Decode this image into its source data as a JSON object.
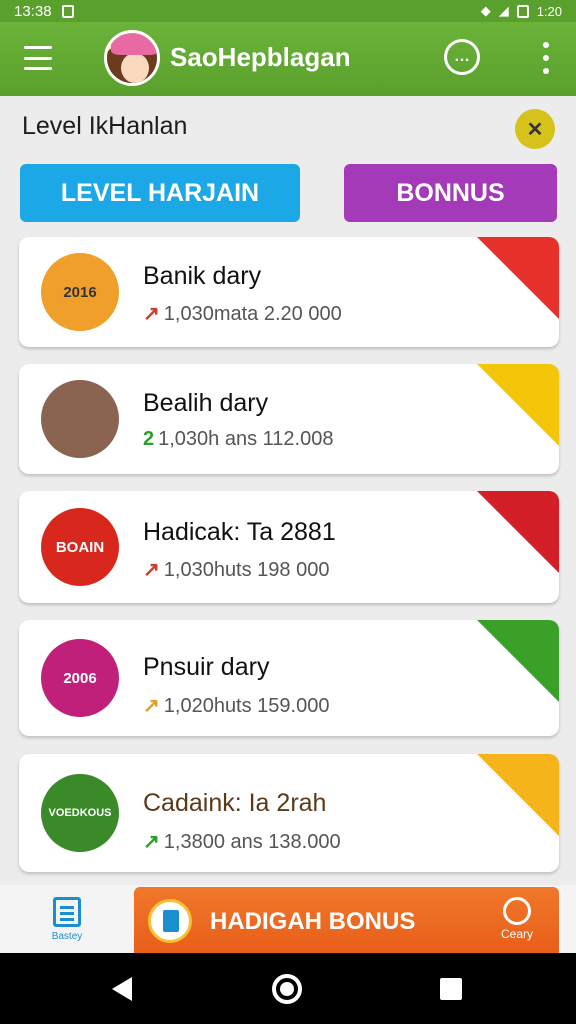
{
  "status": {
    "time": "13:38",
    "battery_text": "1:20"
  },
  "app": {
    "title": "SaoHepblagan"
  },
  "section": {
    "title": "Level IkHanlan"
  },
  "tabs": [
    {
      "label": "LEVEL HARJAIN",
      "color": "#1ca8e6"
    },
    {
      "label": "BONNUS",
      "color": "#a43ab8"
    }
  ],
  "cards": [
    {
      "title": "Banik dary",
      "arrow": "↗",
      "arrow_color": "#d23a2a",
      "subtitle": "1,030mata 2.20 000",
      "icon_text": "2016",
      "icon_bg": "#f0a02a",
      "ribbon_color": "#e8302a"
    },
    {
      "title": "Bealih dary",
      "arrow": "2",
      "arrow_color": "#2aa02a",
      "subtitle": "1,030h ans 112.008",
      "icon_text": "",
      "icon_bg": "#8a6450",
      "ribbon_color": "#f4c60a"
    },
    {
      "title": "Hadicak: Ta 2881",
      "arrow": "↗",
      "arrow_color": "#d23a2a",
      "subtitle": "1,030huts 198 000",
      "icon_text": "BOAIN",
      "icon_bg": "#d8281e",
      "ribbon_color": "#d41e28"
    },
    {
      "title": "Pnsuir dary",
      "arrow": "↗",
      "arrow_color": "#e0a020",
      "subtitle": "1,020huts 159.000",
      "icon_text": "2006",
      "icon_bg": "#c0207a",
      "ribbon_color": "#3aa02a"
    },
    {
      "title": "Cadaink: Ia 2rah",
      "arrow": "↗",
      "arrow_color": "#2aa02a",
      "subtitle": "1,3800 ans 138.000",
      "icon_text": "VOEDKOUS",
      "icon_bg": "#3a8a2a",
      "ribbon_color": "#f4b41a"
    }
  ],
  "bottom": {
    "home_label": "Bastey",
    "bonus_label": "HADIGAH BONUS",
    "side_label": "Ceary"
  }
}
